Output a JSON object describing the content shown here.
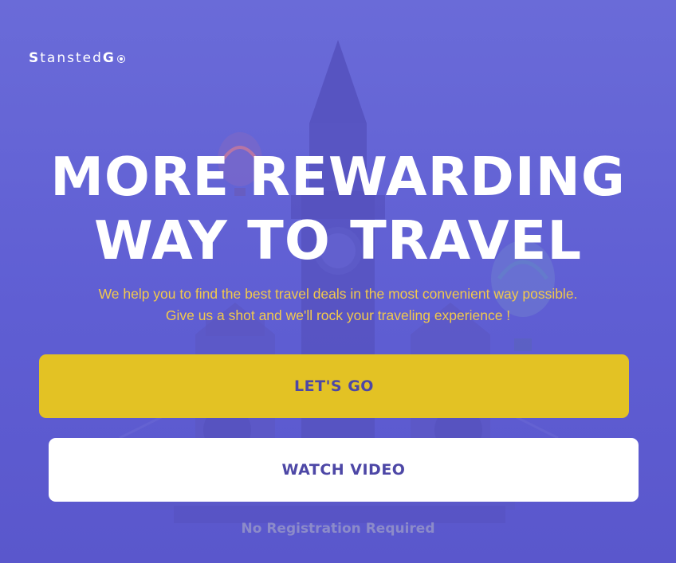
{
  "brand": {
    "logo_first": "S",
    "logo_middle": "tansted",
    "logo_last": "G"
  },
  "hero": {
    "headline_line1": "MORE REWARDING",
    "headline_line2": "WAY TO TRAVEL",
    "subtext_line1": "We help you to find the best travel deals in the most convenient way possible.",
    "subtext_line2": "Give us a shot and we'll rock your traveling experience !"
  },
  "actions": {
    "primary_label": "LET'S GO",
    "secondary_label": "WATCH VIDEO",
    "note": "No Registration Required"
  },
  "colors": {
    "background": "#6365d5",
    "primary_button": "#e3c224",
    "secondary_button": "#ffffff",
    "button_text": "#4d47a6",
    "subtext": "#f2c94c"
  },
  "icons": {
    "background_illustration": "big-ben-tower-balloons-illustration",
    "logo_badge": "circle-dot-icon"
  }
}
